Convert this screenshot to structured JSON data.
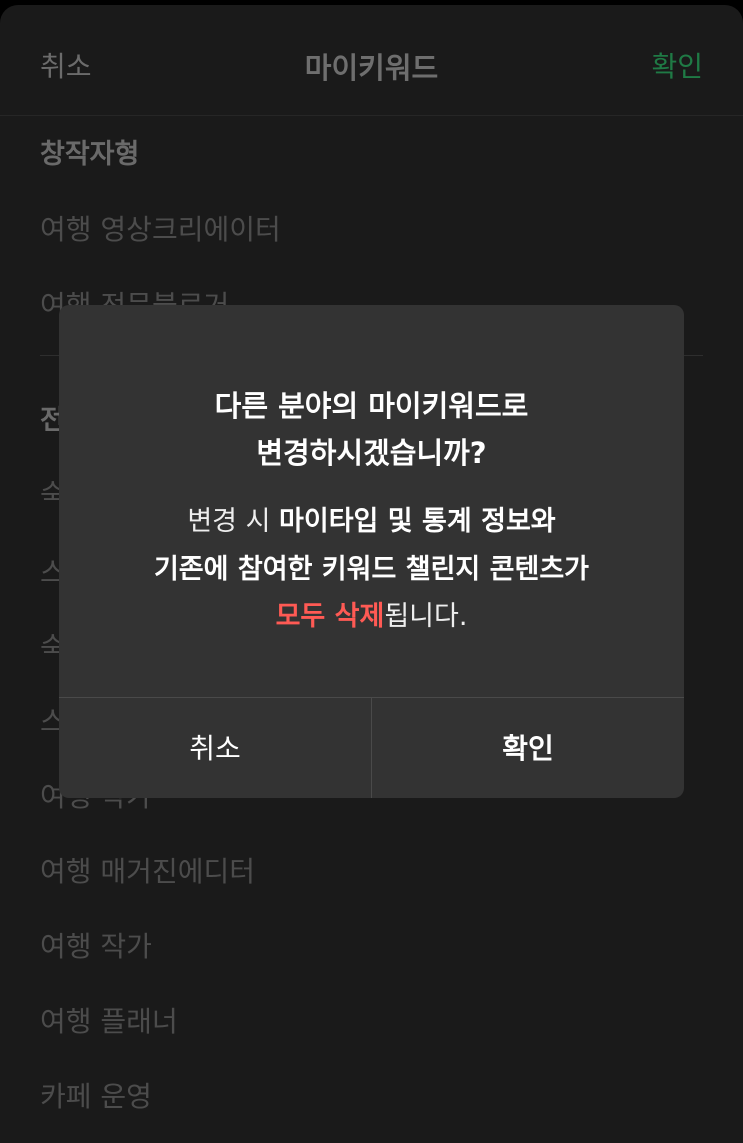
{
  "header": {
    "cancel_label": "취소",
    "title": "마이키워드",
    "confirm_label": "확인",
    "confirm_color": "#1f7a45"
  },
  "sections": [
    {
      "title": "창작자형",
      "items": [
        "여행 영상크리에이터",
        "여행 전문블로거"
      ]
    },
    {
      "title": "전",
      "items": [
        "숙",
        "스",
        "숙",
        "스",
        "여행 작가",
        "여행 매거진에디터",
        "여행 작가",
        "여행 플래너",
        "카페 운영"
      ]
    }
  ],
  "dialog": {
    "title_line1": "다른 분야의 마이키워드로",
    "title_line2": "변경하시겠습니까?",
    "body_line1_plain": "변경 시 ",
    "body_line1_bold": "마이타입 및 통계 정보와",
    "body_line2_bold": "기존에 참여한 키워드 챌린지 콘텐츠가",
    "body_line3_danger": "모두 삭제",
    "body_line3_plain": "됩니다.",
    "danger_color": "#ff5a54",
    "cancel_label": "취소",
    "confirm_label": "확인"
  }
}
